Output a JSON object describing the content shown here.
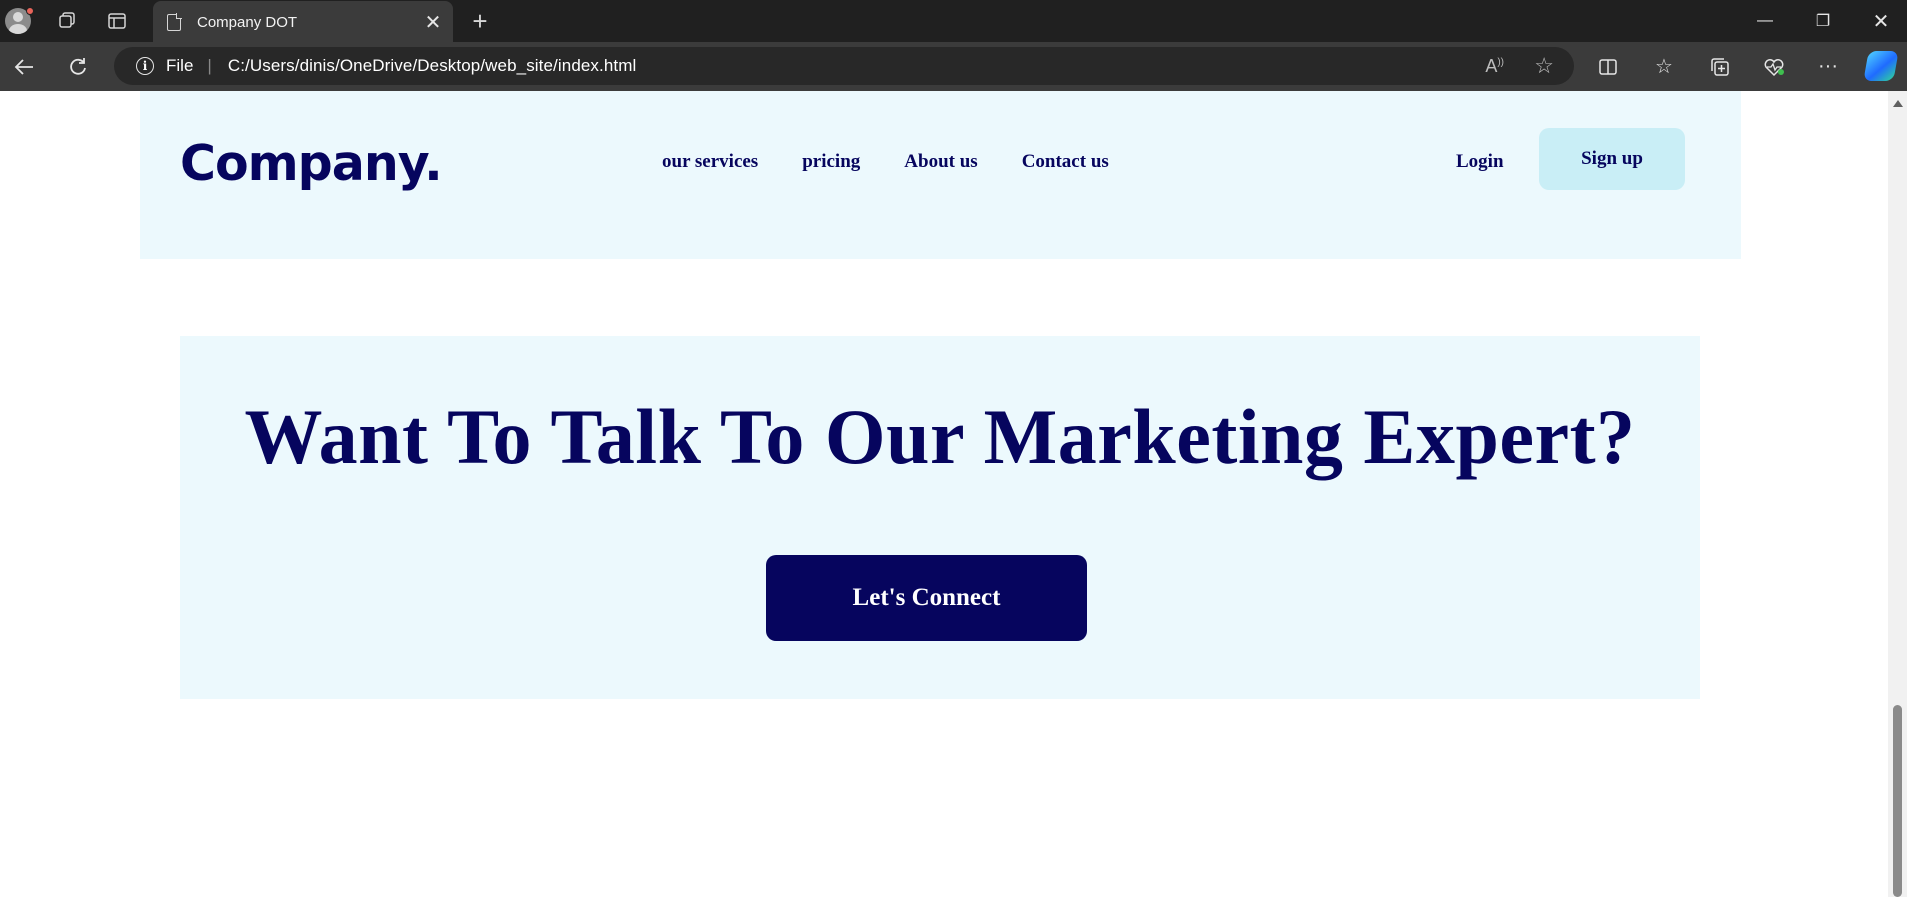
{
  "browser": {
    "tab_title": "Company DOT",
    "tab_close": "✕",
    "new_tab": "+",
    "address": {
      "protocol_label": "File",
      "separator": "|",
      "url": "C:/Users/dinis/OneDrive/Desktop/web_site/index.html"
    },
    "icons": {
      "profile": "profile-avatar-icon",
      "workspaces": "workspaces-icon",
      "tab_actions": "tab-actions-icon",
      "back": "back-arrow-icon",
      "refresh": "refresh-icon",
      "info": "info-icon",
      "read_aloud": "read-aloud-icon",
      "favorite": "star-icon",
      "split": "split-screen-icon",
      "favorites": "favorites-icon",
      "collections": "collections-icon",
      "health": "browser-essentials-icon",
      "more": "more-icon",
      "copilot": "copilot-icon"
    },
    "window": {
      "minimize": "—",
      "restore": "❐",
      "close": "✕"
    }
  },
  "site": {
    "logo": "Company.",
    "nav": [
      {
        "label": "our services"
      },
      {
        "label": "pricing"
      },
      {
        "label": "About us"
      },
      {
        "label": "Contact us"
      }
    ],
    "login": "Login",
    "signup": "Sign up",
    "cta": {
      "heading": "Want To Talk To Our Marketing Expert?",
      "button": "Let's Connect"
    }
  },
  "colors": {
    "navy": "#06055e",
    "light_section": "#ecf9fd",
    "signup_bg": "#c9eef6",
    "chrome_dark": "#202020",
    "chrome_mid": "#3b3b3b"
  }
}
